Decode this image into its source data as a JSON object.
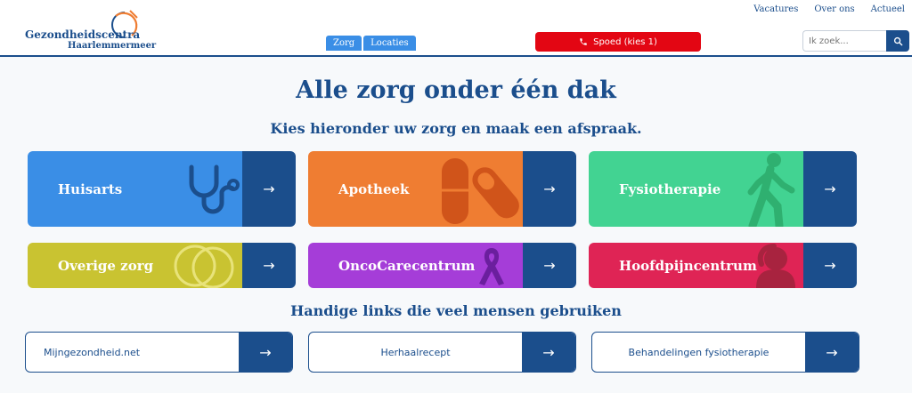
{
  "logo": {
    "line1": "Gezondheidscentra",
    "line2": "Haarlemmermeer"
  },
  "topnav": [
    "Vacatures",
    "Over ons",
    "Actueel"
  ],
  "tabs": [
    "Zorg",
    "Locaties"
  ],
  "spoed": {
    "label": "Spoed (kies 1)",
    "icon": "phone-icon",
    "color": "#e30613"
  },
  "search": {
    "placeholder": "Ik zoek...",
    "icon": "search-icon"
  },
  "main": {
    "title": "Alle zorg onder één dak",
    "subtitle": "Kies hieronder uw zorg en maak een afspraak.",
    "links_title": "Handige links die veel mensen gebruiken"
  },
  "cards": [
    {
      "label": "Huisarts",
      "color": "#3a8ee6",
      "icon": "stethoscope-icon"
    },
    {
      "label": "Apotheek",
      "color": "#ef7d32",
      "icon": "pills-icon"
    },
    {
      "label": "Fysiotherapie",
      "color": "#42d392",
      "icon": "walking-person-icon"
    },
    {
      "label": "Overige zorg",
      "color": "#c9c331",
      "icon": "logo-rings-icon"
    },
    {
      "label": "OncoCarecentrum",
      "color": "#a53dd8",
      "icon": "ribbon-icon"
    },
    {
      "label": "Hoofdpijncentrum",
      "color": "#df2455",
      "icon": "headache-person-icon"
    }
  ],
  "links": [
    "Mijngezondheid.net",
    "Herhaalrecept",
    "Behandelingen fysiotherapie"
  ],
  "arrow_glyph": "→",
  "colors": {
    "brand_blue": "#1b4e8c",
    "accent_orange": "#ef7d32"
  }
}
